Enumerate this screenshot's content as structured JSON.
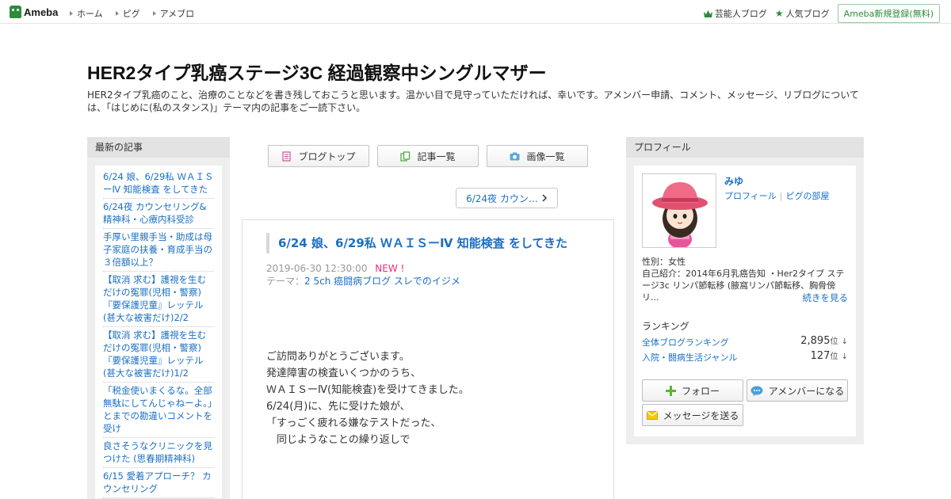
{
  "topbar": {
    "logo": "Ameba",
    "nav": [
      "ホーム",
      "ピグ",
      "アメブロ"
    ],
    "right_links": [
      "芸能人ブログ",
      "人気ブログ"
    ],
    "signup": "Ameba新規登録(無料)"
  },
  "blog": {
    "title": "HER2タイプ乳癌ステージ3C 経過観察中シングルマザー",
    "description": "HER2タイプ乳癌のこと、治療のことなどを書き残しておこうと思います。温かい目で見守っていただければ、幸いです。アメンバー申請、コメント、メッセージ、リブログについては、「はじめに(私のスタンス)」テーマ内の記事をご一読下さい。"
  },
  "left_sidebar": {
    "heading": "最新の記事",
    "items": [
      "6/24 娘、6/29私 ＷＡＩＳーⅣ 知能検査 をしてきた",
      "6/24夜 カウンセリング&精神科・心療内科受診",
      "手厚い里親手当・助成は母子家庭の扶養・育成手当の３倍額以上？",
      "【取消 求む】護視を生むだけの冤罪(児相・警察)『要保護児童』レッテル(甚大な被害だけ)2/2",
      "【取消 求む】護視を生むだけの冤罪(児相・警察)『要保護児童』レッテル(甚大な被害だけ)1/2",
      "「税金使いまくるな。全部無駄にしてんじゃねーよ。」とまでの勘違いコメントを受け",
      "良さそうなクリニックを見つけた (思春期精神科)",
      "6/15 愛着アプローチ？ カウンセリング"
    ]
  },
  "toolbar": {
    "blog_top": "ブログトップ",
    "article_list": "記事一覧",
    "image_list": "画像一覧"
  },
  "pager": {
    "next": "6/24夜 カウン…"
  },
  "article": {
    "title": "6/24 娘、6/29私 ＷＡＩＳーⅣ 知能検査 をしてきた",
    "date": "2019-06-30 12:30:00",
    "new_badge": "NEW !",
    "theme_label": "テーマ：",
    "theme": "2 5ch 癌闘病ブログ スレでのイジメ",
    "body": [
      "ご訪問ありがとうございます。",
      "",
      "発達障害の検査いくつかのうち、",
      "ＷＡＩＳーⅣ(知能検査)を受けてきました。",
      "",
      "6/24(月)に、先に受けた娘が、",
      "",
      "「すっごく疲れる嫌なテストだった、",
      "　同じようなことの繰り返しで"
    ]
  },
  "right_sidebar": {
    "heading": "プロフィール",
    "name": "みゆ",
    "profile_link": "プロフィール",
    "pigg_link": "ピグの部屋",
    "gender": "性別：女性",
    "intro": "自己紹介：2014年6月乳癌告知 ・Her2タイプ ステージ3c リンパ節転移 (腋窩リンパ節転移、胸骨傍リ...",
    "more": "続きを見る",
    "ranking_title": "ランキング",
    "rankings": [
      {
        "name": "全体ブログランキング",
        "value": "2,895",
        "unit": "位",
        "arrow": "↓"
      },
      {
        "name": "入院・闘病生活ジャンル",
        "value": "127",
        "unit": "位",
        "arrow": "↓"
      }
    ],
    "follow": "フォロー",
    "amember": "アメンバーになる",
    "message": "メッセージを送る"
  },
  "colors": {
    "link": "#1a6fc4",
    "brand": "#2d8c3c",
    "new_badge": "#e0327c"
  }
}
